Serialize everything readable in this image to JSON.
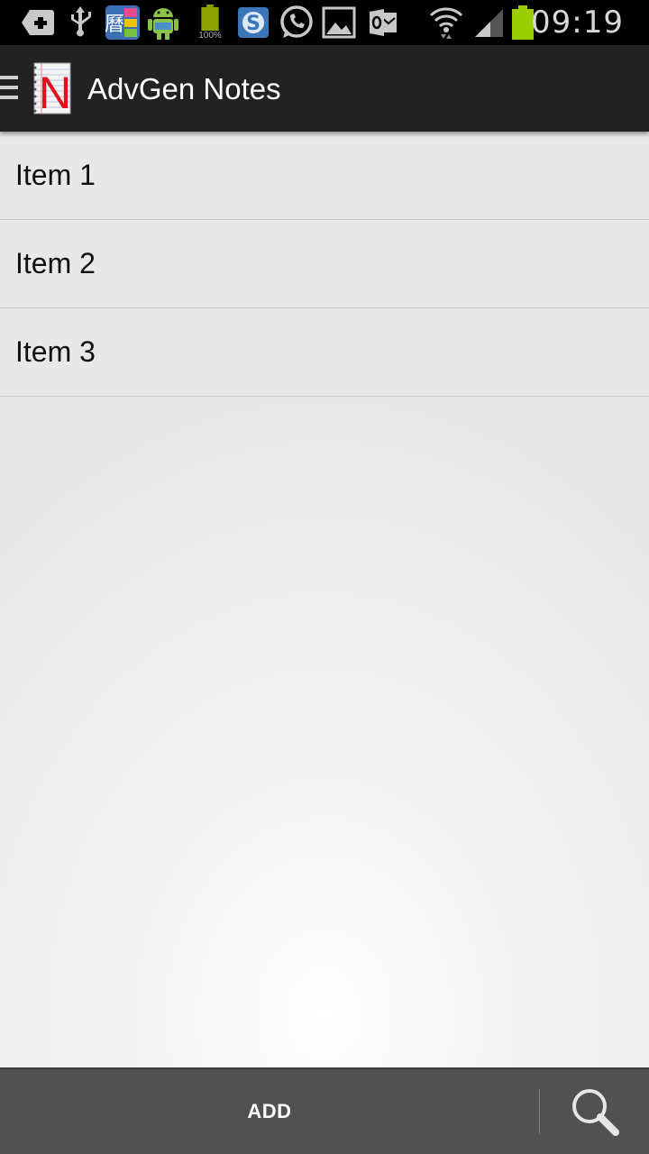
{
  "status_bar": {
    "time": "09:19",
    "battery_widget_text": "100%",
    "icons": [
      "plus-notification-icon",
      "usb-icon",
      "calendar-app-icon",
      "android-icon",
      "battery-widget-icon",
      "skype-icon",
      "whatsapp-icon",
      "gallery-icon",
      "outlook-icon",
      "wifi-icon",
      "signal-icon",
      "battery-icon"
    ]
  },
  "action_bar": {
    "title": "AdvGen Notes",
    "logo_letter": "N"
  },
  "list": {
    "items": [
      {
        "label": "Item 1"
      },
      {
        "label": "Item 2"
      },
      {
        "label": "Item 3"
      }
    ]
  },
  "bottom_bar": {
    "add_label": "ADD"
  },
  "colors": {
    "status_bar_bg": "#000000",
    "action_bar_bg": "#222222",
    "bottom_bar_bg": "#515151",
    "battery_green": "#9acd00",
    "logo_red": "#e0101c"
  }
}
